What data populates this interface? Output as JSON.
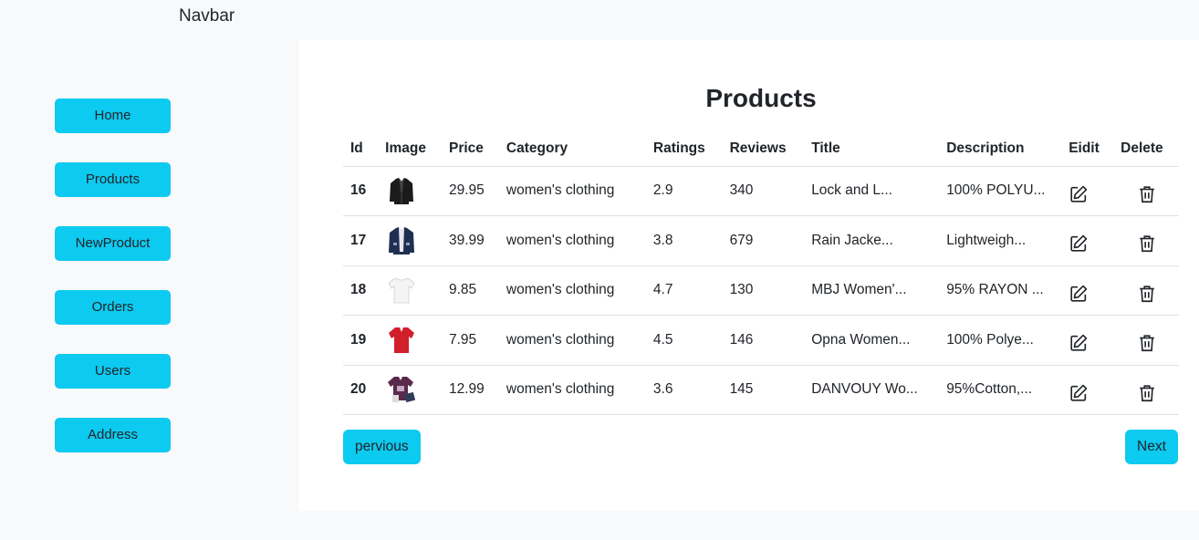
{
  "navbar": {
    "brand": "Navbar"
  },
  "sidebar": {
    "items": [
      {
        "label": "Home"
      },
      {
        "label": "Products"
      },
      {
        "label": "NewProduct"
      },
      {
        "label": "Orders"
      },
      {
        "label": "Users"
      },
      {
        "label": "Address"
      }
    ]
  },
  "main": {
    "title": "Products",
    "table": {
      "headers": [
        "Id",
        "Image",
        "Price",
        "Category",
        "Ratings",
        "Reviews",
        "Title",
        "Description",
        "Eidit",
        "Delete"
      ],
      "rows": [
        {
          "id": "16",
          "image": "black-leather-jacket",
          "price": "29.95",
          "category": "women's clothing",
          "rating": "2.9",
          "reviews": "340",
          "title": "Lock and L...",
          "description": "100% POLYU..."
        },
        {
          "id": "17",
          "image": "navy-rain-jacket",
          "price": "39.99",
          "category": "women's clothing",
          "rating": "3.8",
          "reviews": "679",
          "title": "Rain Jacke...",
          "description": "Lightweigh..."
        },
        {
          "id": "18",
          "image": "white-tshirt",
          "price": "9.85",
          "category": "women's clothing",
          "rating": "4.7",
          "reviews": "130",
          "title": "MBJ Women'...",
          "description": "95% RAYON ..."
        },
        {
          "id": "19",
          "image": "red-tshirt",
          "price": "7.95",
          "category": "women's clothing",
          "rating": "4.5",
          "reviews": "146",
          "title": "Opna Women...",
          "description": "100% Polye..."
        },
        {
          "id": "20",
          "image": "purple-tshirt",
          "price": "12.99",
          "category": "women's clothing",
          "rating": "3.6",
          "reviews": "145",
          "title": "DANVOUY Wo...",
          "description": "95%Cotton,..."
        }
      ]
    },
    "pagination": {
      "prev_label": "pervious",
      "next_label": "Next"
    }
  },
  "colors": {
    "accent": "#0dcaf0",
    "page_bg": "#f8f9fa",
    "panel_bg": "#ffffff"
  },
  "icons": {
    "edit": "pencil-square-icon",
    "delete": "trash-icon"
  }
}
